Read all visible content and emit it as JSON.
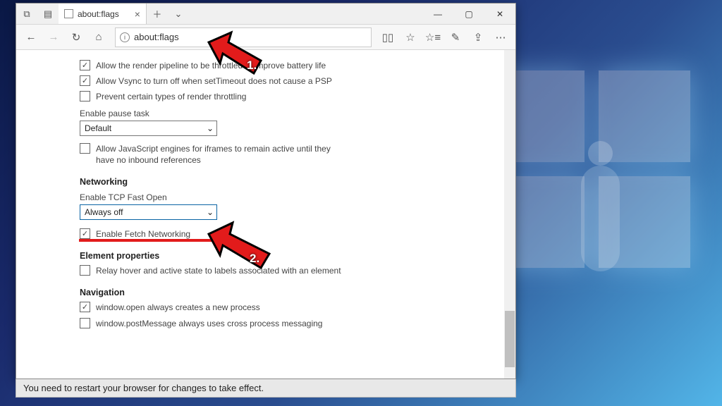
{
  "window": {
    "tab_title": "about:flags",
    "min_tip": "Minimize",
    "max_tip": "Maximize",
    "close_tip": "Close"
  },
  "toolbar": {
    "url": "about:flags"
  },
  "flags": {
    "render_pipeline": "Allow the render pipeline to be throttled to improve battery life",
    "vsync": "Allow Vsync to turn off when setTimeout does not cause a PSP",
    "render_throttle": "Prevent certain types of render throttling",
    "pause_task_label": "Enable pause task",
    "pause_task_value": "Default",
    "js_iframes": "Allow JavaScript engines for iframes to remain active until they have no inbound references",
    "section_networking": "Networking",
    "tcp_label": "Enable TCP Fast Open",
    "tcp_value": "Always off",
    "fetch_net": "Enable Fetch Networking",
    "section_element": "Element properties",
    "relay_hover": "Relay hover and active state to labels associated with an element",
    "section_navigation": "Navigation",
    "win_open": "window.open always creates a new process",
    "post_msg": "window.postMessage always uses cross process messaging"
  },
  "restart_msg": "You need to restart your browser for changes to take effect.",
  "annotations": {
    "a1": "1.",
    "a2": "2."
  }
}
